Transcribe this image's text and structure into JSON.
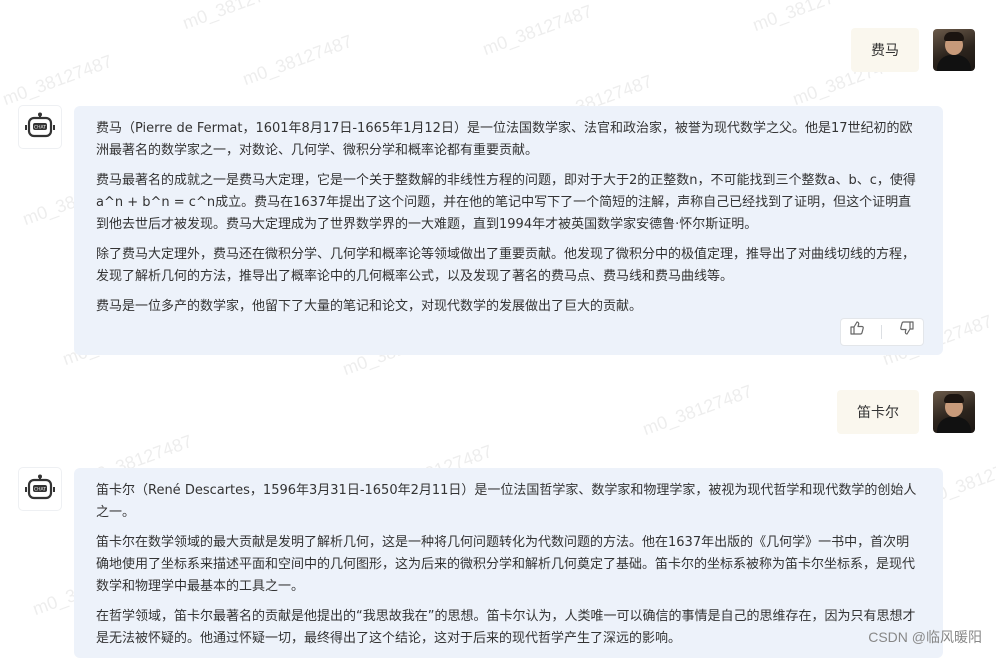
{
  "watermark": "m0_38127487",
  "conversation": [
    {
      "user": {
        "text": "费马"
      },
      "bot": {
        "paragraphs": [
          "费马（Pierre de Fermat，1601年8月17日-1665年1月12日）是一位法国数学家、法官和政治家，被誉为现代数学之父。他是17世纪初的欧洲最著名的数学家之一，对数论、几何学、微积分学和概率论都有重要贡献。",
          "费马最著名的成就之一是费马大定理，它是一个关于整数解的非线性方程的问题，即对于大于2的正整数n，不可能找到三个整数a、b、c，使得a^n + b^n = c^n成立。费马在1637年提出了这个问题，并在他的笔记中写下了一个简短的注解，声称自己已经找到了证明，但这个证明直到他去世后才被发现。费马大定理成为了世界数学界的一大难题，直到1994年才被英国数学家安德鲁·怀尔斯证明。",
          "除了费马大定理外，费马还在微积分学、几何学和概率论等领域做出了重要贡献。他发现了微积分中的极值定理，推导出了对曲线切线的方程，发现了解析几何的方法，推导出了概率论中的几何概率公式，以及发现了著名的费马点、费马线和费马曲线等。",
          "费马是一位多产的数学家，他留下了大量的笔记和论文，对现代数学的发展做出了巨大的贡献。"
        ]
      }
    },
    {
      "user": {
        "text": "笛卡尔"
      },
      "bot": {
        "paragraphs": [
          "笛卡尔（René Descartes，1596年3月31日-1650年2月11日）是一位法国哲学家、数学家和物理学家，被视为现代哲学和现代数学的创始人之一。",
          "笛卡尔在数学领域的最大贡献是发明了解析几何，这是一种将几何问题转化为代数问题的方法。他在1637年出版的《几何学》一书中，首次明确地使用了坐标系来描述平面和空间中的几何图形，这为后来的微积分学和解析几何奠定了基础。笛卡尔的坐标系被称为笛卡尔坐标系，是现代数学和物理学中最基本的工具之一。",
          "在哲学领域，笛卡尔最著名的贡献是他提出的“我思故我在”的思想。笛卡尔认为，人类唯一可以确信的事情是自己的思维存在，因为只有思想才是无法被怀疑的。他通过怀疑一切，最终得出了这个结论，这对于后来的现代哲学产生了深远的影响。"
        ]
      }
    }
  ],
  "footer": {
    "csdn": "CSDN @临风暖阳"
  }
}
